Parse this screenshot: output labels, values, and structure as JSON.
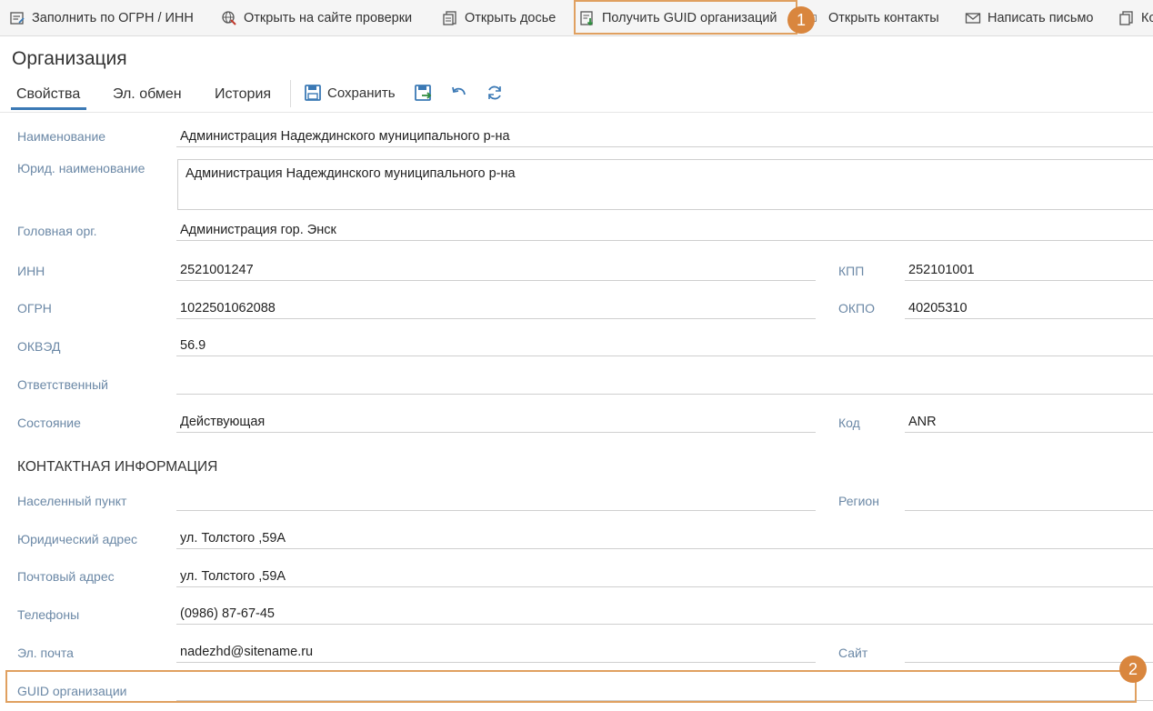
{
  "toolbar": {
    "fill": "Заполнить по ОГРН / ИНН",
    "open_check": "Открыть на сайте проверки",
    "open_dossier": "Открыть досье",
    "get_guid": "Получить GUID организаций",
    "open_contacts": "Открыть контакты",
    "write_letter": "Написать письмо",
    "more": "Ко"
  },
  "badges": {
    "one": "1",
    "two": "2"
  },
  "page": {
    "title": "Организация"
  },
  "tabs": {
    "properties": "Свойства",
    "exchange": "Эл. обмен",
    "history": "История"
  },
  "actions": {
    "save": "Сохранить",
    "icons": [
      "save-close-icon",
      "undo-icon",
      "refresh-icon"
    ]
  },
  "labels": {
    "name": "Наименование",
    "legal_name": "Юрид. наименование",
    "head_org": "Головная орг.",
    "inn": "ИНН",
    "kpp": "КПП",
    "ogrn": "ОГРН",
    "okpo": "ОКПО",
    "okved": "ОКВЭД",
    "responsible": "Ответственный",
    "status": "Состояние",
    "code": "Код",
    "contact_section": "КОНТАКТНАЯ ИНФОРМАЦИЯ",
    "locality": "Населенный пункт",
    "region": "Регион",
    "legal_address": "Юридический адрес",
    "postal_address": "Почтовый адрес",
    "phones": "Телефоны",
    "email": "Эл. почта",
    "site": "Сайт",
    "guid": "GUID организации"
  },
  "values": {
    "name": "Администрация Надеждинского муниципального р-на",
    "legal_name": "Администрация Надеждинского муниципального р-на",
    "head_org": "Администрация гор. Энск",
    "inn": "2521001247",
    "kpp": "252101001",
    "ogrn": "1022501062088",
    "okpo": "40205310",
    "okved": "56.9",
    "responsible": "",
    "status": "Действующая",
    "code": "ANR",
    "locality": "",
    "region": "",
    "legal_address": "ул. Толстого ,59А",
    "postal_address": "ул. Толстого ,59А",
    "phones": "(0986) 87-67-45",
    "email": "nadezhd@sitename.ru",
    "site": "",
    "guid": ""
  },
  "colors": {
    "accent": "#3b79b5",
    "highlight": "#e0a060",
    "badge": "#d9863e",
    "label": "#6b88a6"
  }
}
